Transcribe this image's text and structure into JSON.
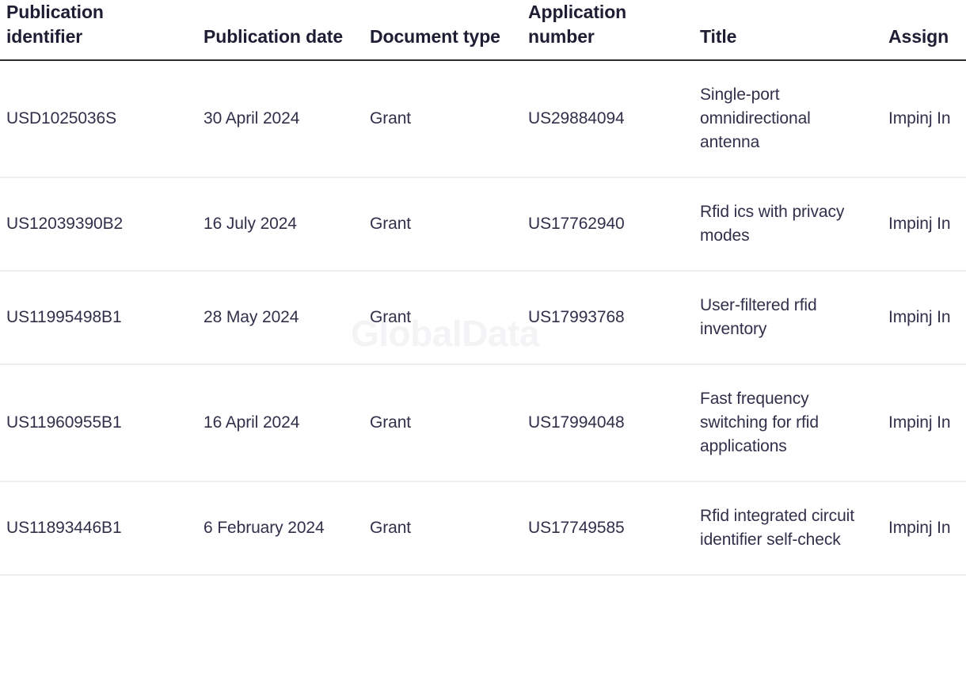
{
  "watermark": {
    "text": "GlobalData"
  },
  "table": {
    "columns": [
      {
        "key": "publication_identifier",
        "label": "Publication identifier"
      },
      {
        "key": "publication_date",
        "label": "Publication date"
      },
      {
        "key": "document_type",
        "label": "Document type"
      },
      {
        "key": "application_number",
        "label": "Application number"
      },
      {
        "key": "title",
        "label": "Title"
      },
      {
        "key": "assignee",
        "label": "Assign"
      }
    ],
    "rows": [
      {
        "publication_identifier": "USD1025036S",
        "publication_date": "30 April 2024",
        "document_type": "Grant",
        "application_number": "US29884094",
        "title": "Single-port omnidirectional antenna",
        "assignee": "Impinj In"
      },
      {
        "publication_identifier": "US12039390B2",
        "publication_date": "16 July 2024",
        "document_type": "Grant",
        "application_number": "US17762940",
        "title": "Rfid ics with privacy modes",
        "assignee": "Impinj In"
      },
      {
        "publication_identifier": "US11995498B1",
        "publication_date": "28 May 2024",
        "document_type": "Grant",
        "application_number": "US17993768",
        "title": "User-filtered rfid inventory",
        "assignee": "Impinj In"
      },
      {
        "publication_identifier": "US11960955B1",
        "publication_date": "16 April 2024",
        "document_type": "Grant",
        "application_number": "US17994048",
        "title": "Fast frequency switching for rfid applications",
        "assignee": "Impinj In"
      },
      {
        "publication_identifier": "US11893446B1",
        "publication_date": "6 February 2024",
        "document_type": "Grant",
        "application_number": "US17749585",
        "title": "Rfid integrated circuit identifier self-check",
        "assignee": "Impinj In"
      }
    ]
  },
  "colors": {
    "text_dark": "#1d1d33",
    "text_body": "#30304a",
    "header_rule": "#2c2c2c",
    "row_rule": "#edeef1",
    "watermark": "#f4f4f6",
    "background": "#ffffff"
  }
}
